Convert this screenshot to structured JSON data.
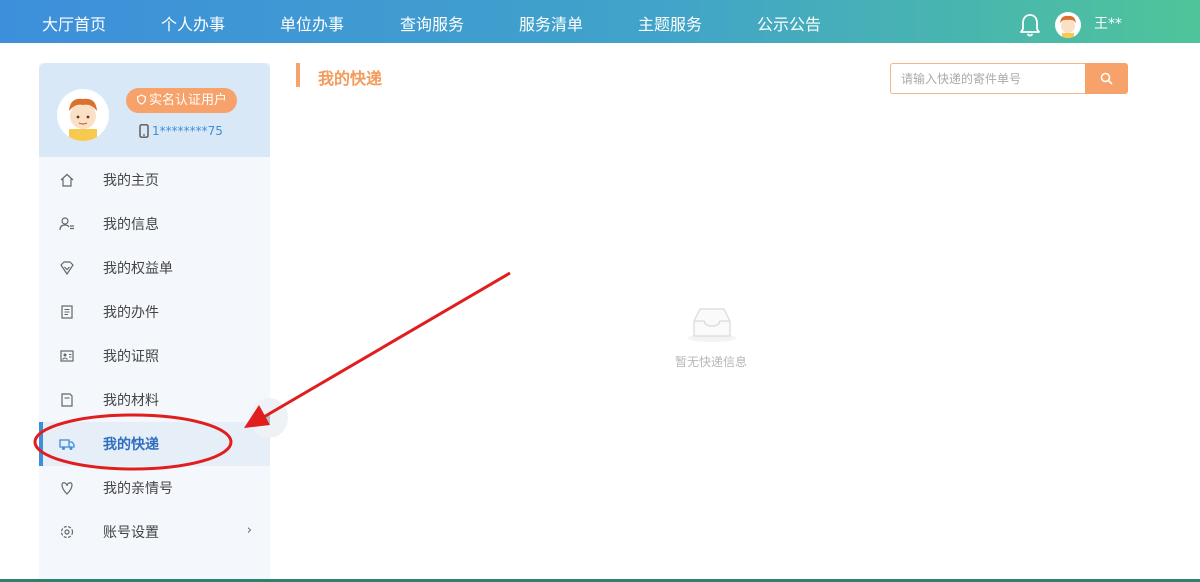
{
  "topnav": {
    "items": [
      "大厅首页",
      "个人办事",
      "单位办事",
      "查询服务",
      "服务清单",
      "主题服务",
      "公示公告"
    ],
    "username": "王**"
  },
  "sidebar": {
    "badge": "实名认证用户",
    "phone": "1********75",
    "menu": [
      {
        "label": "我的主页",
        "icon": "home-icon"
      },
      {
        "label": "我的信息",
        "icon": "user-info-icon"
      },
      {
        "label": "我的权益单",
        "icon": "shield-heart-icon"
      },
      {
        "label": "我的办件",
        "icon": "document-list-icon"
      },
      {
        "label": "我的证照",
        "icon": "id-card-icon"
      },
      {
        "label": "我的材料",
        "icon": "folder-icon"
      },
      {
        "label": "我的快递",
        "icon": "delivery-truck-icon"
      },
      {
        "label": "我的亲情号",
        "icon": "family-icon"
      },
      {
        "label": "账号设置",
        "icon": "gear-icon"
      }
    ],
    "active_index": 6,
    "settings_chevron": "›"
  },
  "main": {
    "title": "我的快递",
    "search_placeholder": "请输入快递的寄件单号",
    "empty_text": "暂无快递信息"
  },
  "colors": {
    "accent_orange": "#f6a26a",
    "accent_blue": "#3f8ddb",
    "annotation_red": "#e01e1e"
  }
}
